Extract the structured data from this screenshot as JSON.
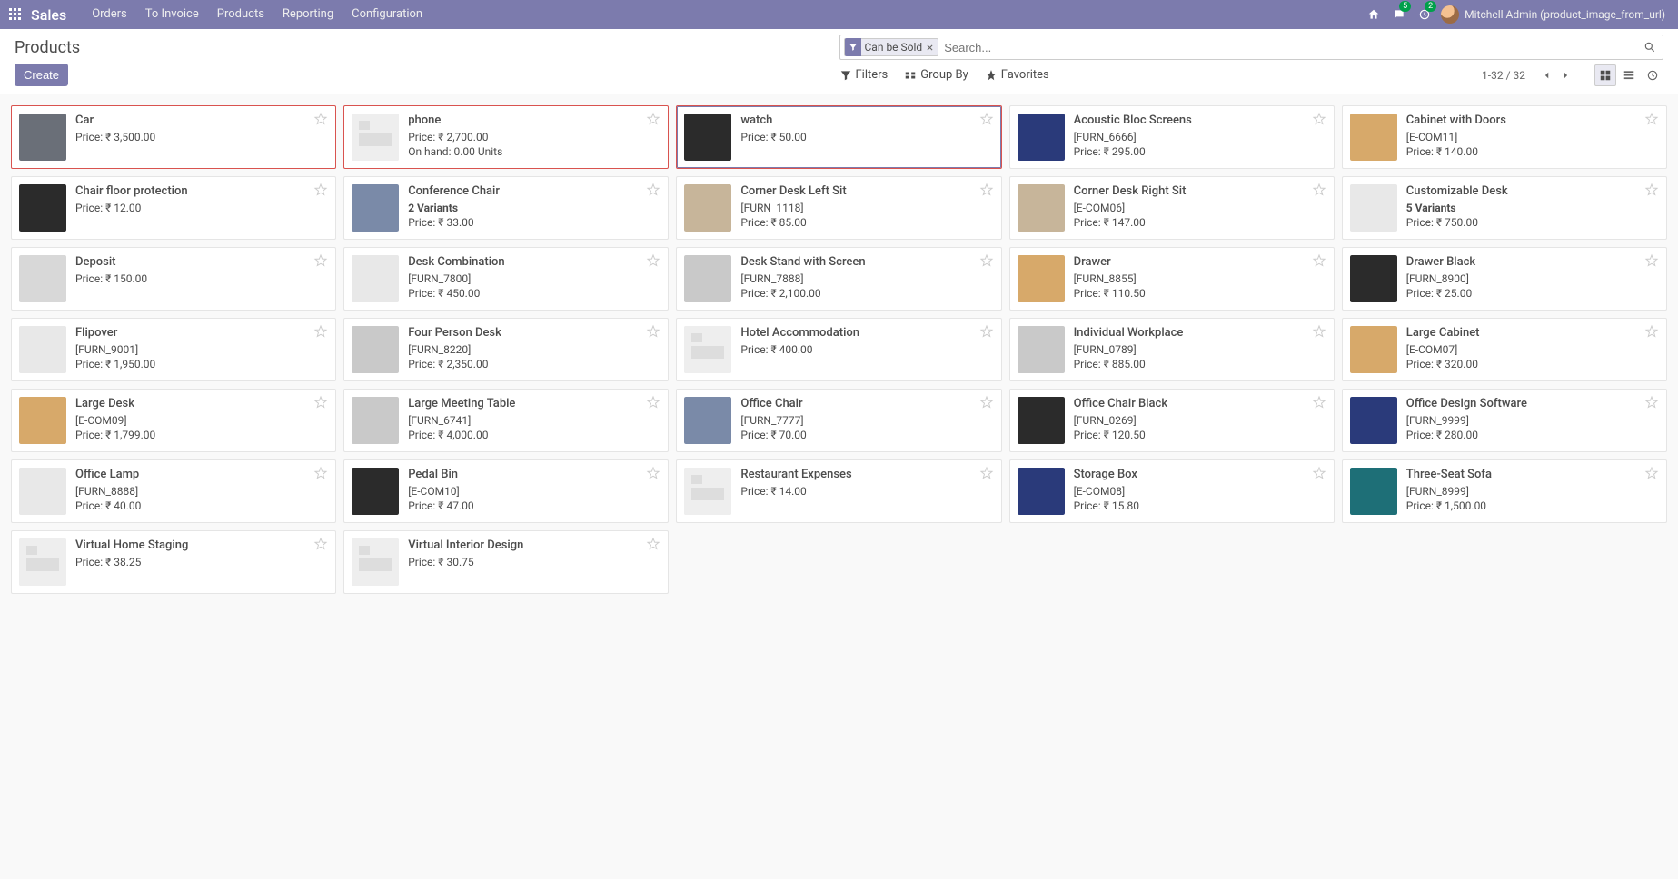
{
  "topbar": {
    "brand": "Sales",
    "menu": [
      "Orders",
      "To Invoice",
      "Products",
      "Reporting",
      "Configuration"
    ],
    "msg_badge": "5",
    "act_badge": "2",
    "user_label": "Mitchell Admin (product_image_from_url)"
  },
  "cp": {
    "title": "Products",
    "create": "Create",
    "filter_tag": "Can be Sold",
    "search_placeholder": "Search...",
    "filters": "Filters",
    "group_by": "Group By",
    "favorites": "Favorites",
    "pager": "1-32 / 32"
  },
  "products": [
    {
      "name": "Car",
      "price": "Price: ₹ 3,500.00",
      "highlight": true,
      "thumb": "car"
    },
    {
      "name": "phone",
      "price": "Price: ₹ 2,700.00",
      "extra": "On hand: 0.00 Units",
      "highlight": true,
      "thumb": "placeholder"
    },
    {
      "name": "watch",
      "price": "Price: ₹ 50.00",
      "highlight": true,
      "selected": true,
      "thumb": "watch"
    },
    {
      "name": "Acoustic Bloc Screens",
      "sku": "[FURN_6666]",
      "price": "Price: ₹ 295.00",
      "thumb": "blue"
    },
    {
      "name": "Cabinet with Doors",
      "sku": "[E-COM11]",
      "price": "Price: ₹ 140.00",
      "thumb": "wood"
    },
    {
      "name": "Chair floor protection",
      "price": "Price: ₹ 12.00",
      "thumb": "dark"
    },
    {
      "name": "Conference Chair",
      "variants": "2 Variants",
      "price": "Price: ₹ 33.00",
      "thumb": "chair"
    },
    {
      "name": "Corner Desk Left Sit",
      "sku": "[FURN_1118]",
      "price": "Price: ₹ 85.00",
      "thumb": "desk"
    },
    {
      "name": "Corner Desk Right Sit",
      "sku": "[E-COM06]",
      "price": "Price: ₹ 147.00",
      "thumb": "desk"
    },
    {
      "name": "Customizable Desk",
      "variants": "5 Variants",
      "price": "Price: ₹ 750.00",
      "thumb": "line"
    },
    {
      "name": "Deposit",
      "price": "Price: ₹ 150.00",
      "thumb": "hand"
    },
    {
      "name": "Desk Combination",
      "sku": "[FURN_7800]",
      "price": "Price: ₹ 450.00",
      "thumb": "line"
    },
    {
      "name": "Desk Stand with Screen",
      "sku": "[FURN_7888]",
      "price": "Price: ₹ 2,100.00",
      "thumb": "grey"
    },
    {
      "name": "Drawer",
      "sku": "[FURN_8855]",
      "price": "Price: ₹ 110.50",
      "thumb": "wood"
    },
    {
      "name": "Drawer Black",
      "sku": "[FURN_8900]",
      "price": "Price: ₹ 25.00",
      "thumb": "dark"
    },
    {
      "name": "Flipover",
      "sku": "[FURN_9001]",
      "price": "Price: ₹ 1,950.00",
      "thumb": "line"
    },
    {
      "name": "Four Person Desk",
      "sku": "[FURN_8220]",
      "price": "Price: ₹ 2,350.00",
      "thumb": "grey"
    },
    {
      "name": "Hotel Accommodation",
      "price": "Price: ₹ 400.00",
      "thumb": "placeholder"
    },
    {
      "name": "Individual Workplace",
      "sku": "[FURN_0789]",
      "price": "Price: ₹ 885.00",
      "thumb": "grey"
    },
    {
      "name": "Large Cabinet",
      "sku": "[E-COM07]",
      "price": "Price: ₹ 320.00",
      "thumb": "wood"
    },
    {
      "name": "Large Desk",
      "sku": "[E-COM09]",
      "price": "Price: ₹ 1,799.00",
      "thumb": "wood"
    },
    {
      "name": "Large Meeting Table",
      "sku": "[FURN_6741]",
      "price": "Price: ₹ 4,000.00",
      "thumb": "grey"
    },
    {
      "name": "Office Chair",
      "sku": "[FURN_7777]",
      "price": "Price: ₹ 70.00",
      "thumb": "chair"
    },
    {
      "name": "Office Chair Black",
      "sku": "[FURN_0269]",
      "price": "Price: ₹ 120.50",
      "thumb": "dark"
    },
    {
      "name": "Office Design Software",
      "sku": "[FURN_9999]",
      "price": "Price: ₹ 280.00",
      "thumb": "blue"
    },
    {
      "name": "Office Lamp",
      "sku": "[FURN_8888]",
      "price": "Price: ₹ 40.00",
      "thumb": "line"
    },
    {
      "name": "Pedal Bin",
      "sku": "[E-COM10]",
      "price": "Price: ₹ 47.00",
      "thumb": "dark"
    },
    {
      "name": "Restaurant Expenses",
      "price": "Price: ₹ 14.00",
      "thumb": "placeholder"
    },
    {
      "name": "Storage Box",
      "sku": "[E-COM08]",
      "price": "Price: ₹ 15.80",
      "thumb": "blue"
    },
    {
      "name": "Three-Seat Sofa",
      "sku": "[FURN_8999]",
      "price": "Price: ₹ 1,500.00",
      "thumb": "teal"
    },
    {
      "name": "Virtual Home Staging",
      "price": "Price: ₹ 38.25",
      "thumb": "placeholder"
    },
    {
      "name": "Virtual Interior Design",
      "price": "Price: ₹ 30.75",
      "thumb": "placeholder"
    }
  ],
  "thumbs": {
    "placeholder": "#eeeeee",
    "car": "#6a6f78",
    "watch": "#2b2b2b",
    "blue": "#2a3a7a",
    "wood": "#d7a96a",
    "dark": "#2b2b2b",
    "chair": "#7a8aa8",
    "desk": "#c7b59a",
    "line": "#e8e8e8",
    "grey": "#c9c9c9",
    "hand": "#d8d8d8",
    "teal": "#1e6f77"
  }
}
